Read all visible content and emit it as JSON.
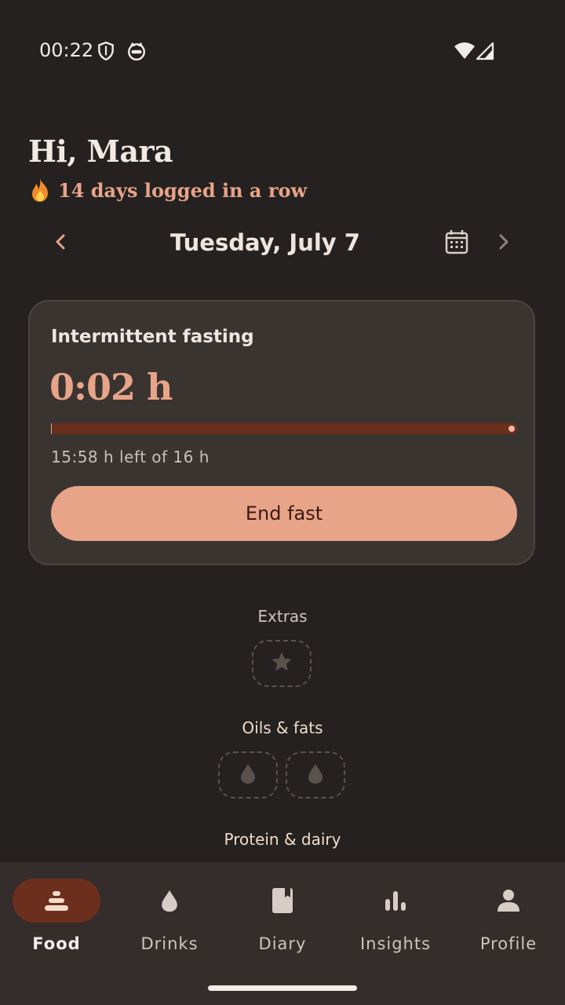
{
  "status_bar": {
    "time": "00:22",
    "icons": [
      "shield-icon",
      "cat-face-icon",
      "wifi-icon",
      "cell-signal-icon"
    ]
  },
  "header": {
    "greeting": "Hi, Mara",
    "streak_text": "14 days logged in a row",
    "streak_icon": "flame-icon"
  },
  "date_nav": {
    "date": "Tuesday, July 7",
    "prev_icon": "chevron-left-icon",
    "next_icon": "chevron-right-icon",
    "calendar_icon": "calendar-icon"
  },
  "fasting_card": {
    "title": "Intermittent fasting",
    "timer": "0:02 h",
    "progress_fraction": 0.002,
    "remaining_text": "15:58 h left of 16 h",
    "end_button": "End fast"
  },
  "sections": [
    {
      "label": "Extras",
      "slot_icon": "star-icon",
      "slots": 1,
      "color": "#cfc4bd"
    },
    {
      "label": "Oils & fats",
      "slot_icon": "droplet-icon",
      "slots": 2,
      "color": "#f2dccb"
    },
    {
      "label": "Protein & dairy",
      "color": "#f2dccb"
    }
  ],
  "bottom_nav": [
    {
      "label": "Food",
      "icon": "food-stack-icon",
      "active": true
    },
    {
      "label": "Drinks",
      "icon": "droplet-icon",
      "active": false
    },
    {
      "label": "Diary",
      "icon": "book-icon",
      "active": false
    },
    {
      "label": "Insights",
      "icon": "bar-chart-icon",
      "active": false
    },
    {
      "label": "Profile",
      "icon": "person-icon",
      "active": false
    }
  ],
  "colors": {
    "background": "#242120",
    "accent": "#e8a488",
    "card": "#3a3431",
    "nav_active": "#6c2f1d"
  }
}
